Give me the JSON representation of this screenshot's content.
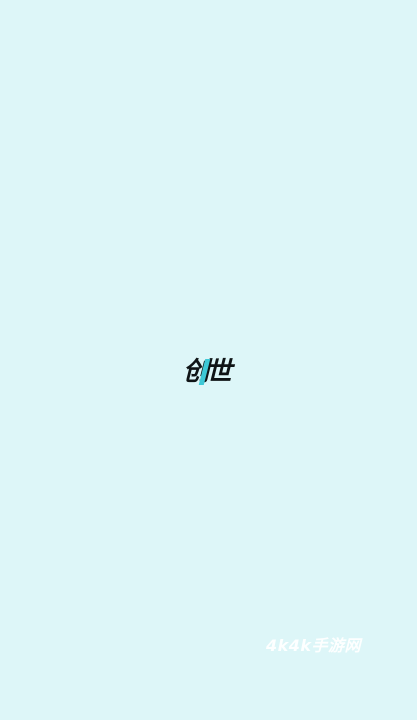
{
  "splash": {
    "logo": {
      "char_1": "创",
      "char_2": "世"
    },
    "watermark": "4k4k手游网"
  },
  "colors": {
    "background": "#ddf6f8",
    "logo_text": "#0f1416",
    "logo_accent": "#3ec8d6",
    "watermark": "#ffffff"
  }
}
